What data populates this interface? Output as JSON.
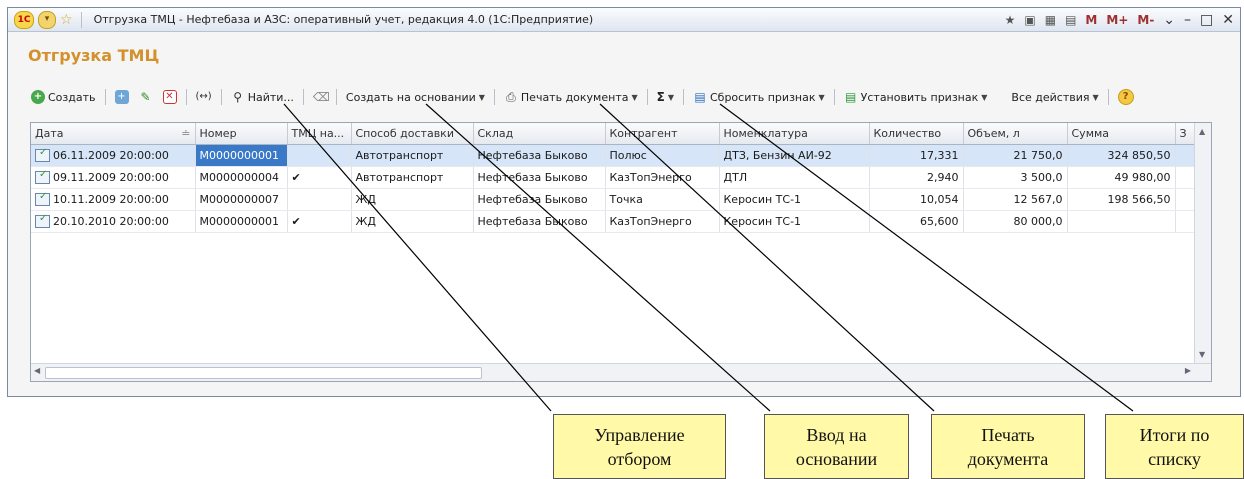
{
  "window": {
    "title": "Отгрузка ТМЦ - Нефтебаза и АЗС: оперативный учет, редакция 4.0  (1С:Предприятие)",
    "right_controls": [
      "M",
      "M+",
      "M-"
    ]
  },
  "page_title": "Отгрузка ТМЦ",
  "toolbar": {
    "create": "Создать",
    "find": "Найти...",
    "create_based_on": "Создать на основании",
    "print_document": "Печать документа",
    "sigma": "Σ",
    "reset_flag": "Сбросить признак",
    "set_flag": "Установить признак",
    "all_actions": "Все действия",
    "help": "?"
  },
  "table": {
    "columns": [
      "Дата",
      "Номер",
      "ТМЦ на...",
      "Способ доставки",
      "Склад",
      "Контрагент",
      "Номенклатура",
      "Количество",
      "Объем, л",
      "Сумма",
      "З"
    ],
    "rows": [
      {
        "date": "06.11.2009 20:00:00",
        "number": "M0000000001",
        "tmc": "",
        "delivery": "Автотранспорт",
        "warehouse": "Нефтебаза Быково",
        "counterparty": "Полюс",
        "item": "ДТЗ, Бензин АИ-92",
        "qty": "17,331",
        "volume": "21 750,0",
        "sum": "324 850,50"
      },
      {
        "date": "09.11.2009 20:00:00",
        "number": "M0000000004",
        "tmc": "✔",
        "delivery": "Автотранспорт",
        "warehouse": "Нефтебаза Быково",
        "counterparty": "КазТопЭнерго",
        "item": "ДТЛ",
        "qty": "2,940",
        "volume": "3 500,0",
        "sum": "49 980,00"
      },
      {
        "date": "10.11.2009 20:00:00",
        "number": "M0000000007",
        "tmc": "",
        "delivery": "ЖД",
        "warehouse": "Нефтебаза Быково",
        "counterparty": "Точка",
        "item": "Керосин ТС-1",
        "qty": "10,054",
        "volume": "12 567,0",
        "sum": "198 566,50"
      },
      {
        "date": "20.10.2010 20:00:00",
        "number": "M0000000001",
        "tmc": "✔",
        "delivery": "ЖД",
        "warehouse": "Нефтебаза Быково",
        "counterparty": "КазТопЭнерго",
        "item": "Керосин ТС-1",
        "qty": "65,600",
        "volume": "80 000,0",
        "sum": ""
      }
    ]
  },
  "callouts": [
    {
      "text1": "Управление",
      "text2": "отбором"
    },
    {
      "text1": "Ввод на",
      "text2": "основании"
    },
    {
      "text1": "Печать",
      "text2": "документа"
    },
    {
      "text1": "Итоги по",
      "text2": "списку"
    }
  ],
  "colors": {
    "accent_title": "#d4902a",
    "selection": "#3a78c8",
    "callout_bg": "#fff9a8"
  }
}
